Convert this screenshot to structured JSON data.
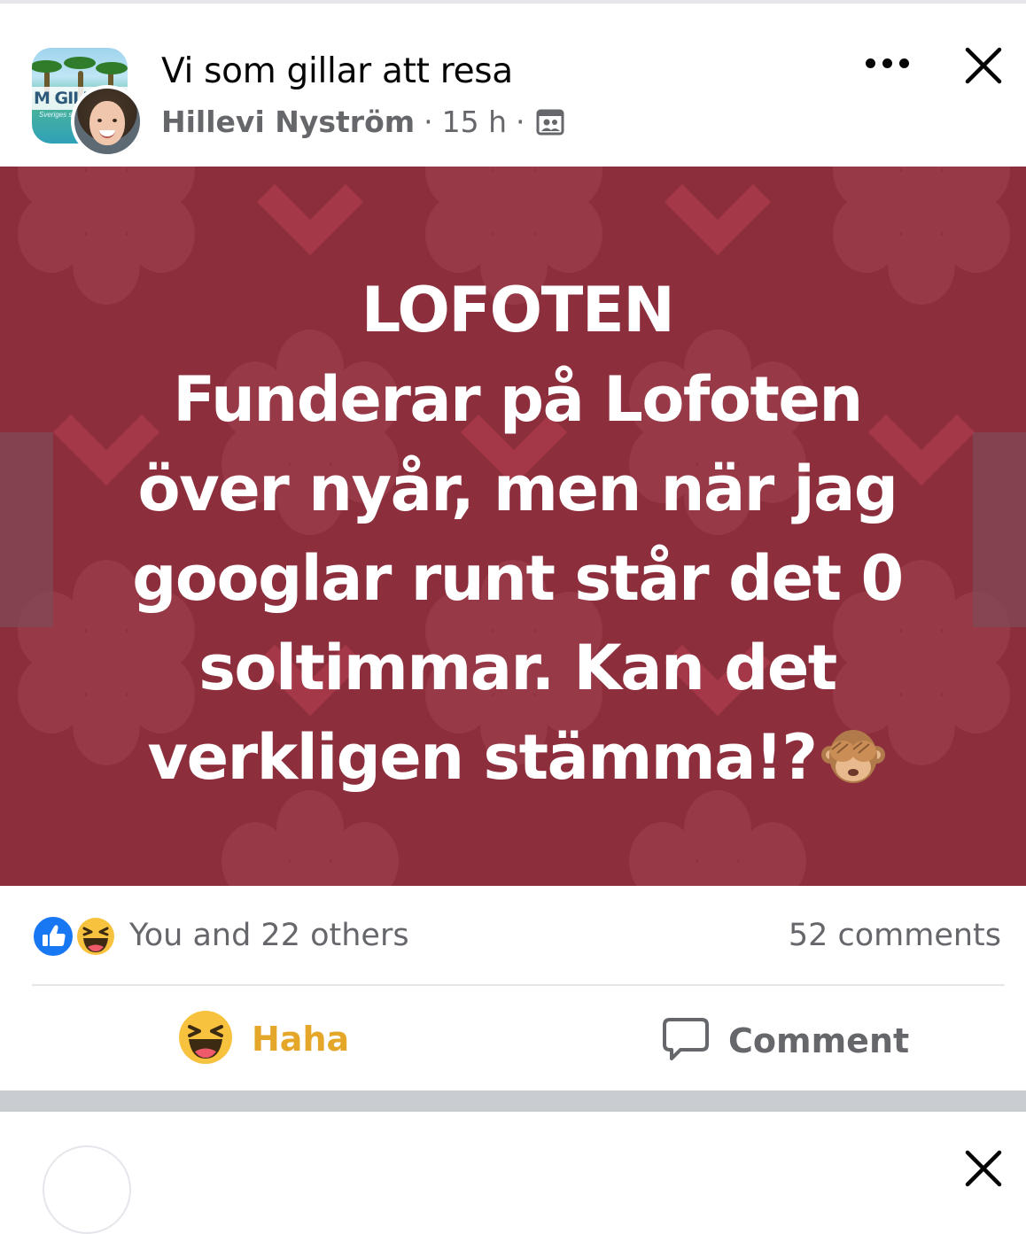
{
  "post": {
    "group_name": "Vi som gillar att resa",
    "author": "Hillevi Nyström",
    "time": "15 h",
    "separator": "·",
    "group_avatar_text": "M GILL",
    "group_avatar_subtext": "Sveriges st",
    "text_lines": [
      "LOFOTEN",
      "Funderar på Lofoten",
      "över nyår, men när jag",
      "googlar runt står det 0",
      "soltimmar.  Kan det",
      "verkligen stämma!?"
    ],
    "background_color": "#8d2e3d"
  },
  "reactions": {
    "summary": "You and 22 others",
    "comments": "52 comments",
    "icons": [
      "like-icon",
      "haha-icon"
    ]
  },
  "actions": {
    "haha_label": "Haha",
    "comment_label": "Comment"
  },
  "colors": {
    "haha_accent": "#e5a72a",
    "like_blue": "#1877f2",
    "secondary_text": "#65676b"
  }
}
